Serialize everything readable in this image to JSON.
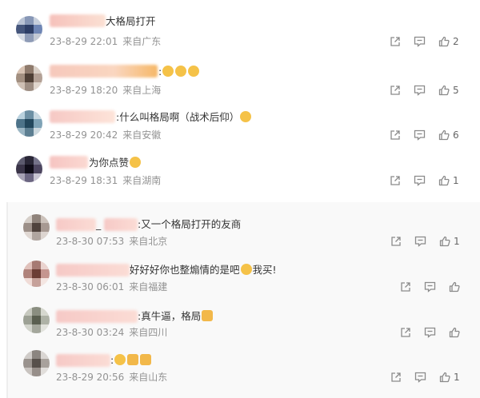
{
  "comments": [
    {
      "suffix": "大格局打开",
      "date": "23-8-29 22:01",
      "loc": "来自广东",
      "likes": "2"
    },
    {
      "suffix": ":",
      "emoji_count": 3,
      "date": "23-8-29 18:20",
      "loc": "来自上海",
      "likes": "5"
    },
    {
      "suffix": ":什么叫格局啊（战术后仰）",
      "emoji_count": 1,
      "date": "23-8-29 20:42",
      "loc": "来自安徽",
      "likes": "6"
    },
    {
      "suffix": "为你点赞",
      "emoji_count": 1,
      "date": "23-8-29 18:31",
      "loc": "来自湖南",
      "likes": "1"
    }
  ],
  "replies": [
    {
      "prefix": "_",
      "suffix": ":又一个格局打开的友商",
      "date": "23-8-30 07:53",
      "loc": "来自北京",
      "likes": "1"
    },
    {
      "suffix": "好好好你也整煽情的是吧",
      "suffix2": "我买!",
      "date": "23-8-30 06:01",
      "loc": "来自福建",
      "likes": ""
    },
    {
      "suffix": ":真牛逼，格局",
      "date": "23-8-30 03:24",
      "loc": "来自四川",
      "likes": ""
    },
    {
      "suffix": ":",
      "date": "23-8-29 20:56",
      "loc": "来自山东",
      "likes": "1"
    }
  ],
  "colors": {
    "meta": "#939393",
    "icon": "#8a8a8a",
    "text": "#333333",
    "panel": "#f9f9f9"
  },
  "icons": [
    "share-icon",
    "comment-icon",
    "like-icon"
  ]
}
